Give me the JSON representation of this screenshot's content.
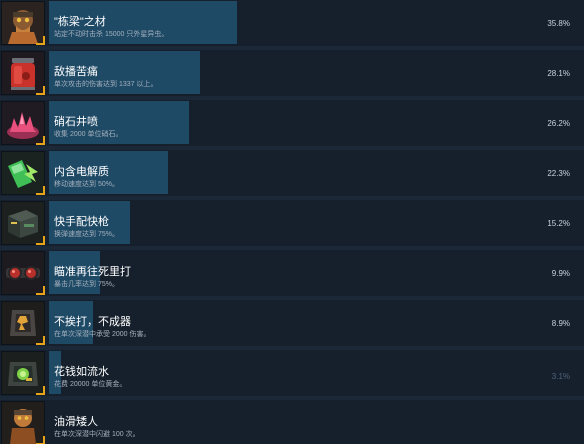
{
  "achievements": [
    {
      "title": "\"栋梁\"之材",
      "description": "站定不动时击杀 15000 只外星异虫。",
      "percent": "35.8%",
      "progress": 35.8,
      "icon": "hammer-dwarf-icon",
      "icon_color": "#b86a2f"
    },
    {
      "title": "敌播苦痛",
      "description": "单次攻击的伤害达到 1337 以上。",
      "percent": "28.1%",
      "progress": 28.1,
      "icon": "red-jar-icon",
      "icon_color": "#c8322a"
    },
    {
      "title": "硝石井喷",
      "description": "收集 2000 单位硝石。",
      "percent": "26.2%",
      "progress": 26.2,
      "icon": "pink-crystal-icon",
      "icon_color": "#e8507d"
    },
    {
      "title": "内含电解质",
      "description": "移动速度达到 50%。",
      "percent": "22.3%",
      "progress": 22.3,
      "icon": "energy-drink-icon",
      "icon_color": "#3fbf55"
    },
    {
      "title": "快手配快枪",
      "description": "换弹速度达到 75%。",
      "percent": "15.2%",
      "progress": 15.2,
      "icon": "ammo-crate-icon",
      "icon_color": "#5a8a5f"
    },
    {
      "title": "瞄准再往死里打",
      "description": "暴击几率达到 75%。",
      "percent": "9.9%",
      "progress": 9.9,
      "icon": "goggles-icon",
      "icon_color": "#b8302c"
    },
    {
      "title": "不挨打，不成器",
      "description": "在单次深潜中承受 2000 伤害。",
      "percent": "8.9%",
      "progress": 8.9,
      "icon": "armor-plate-icon",
      "icon_color": "#e0a43a"
    },
    {
      "title": "花钱如流水",
      "description": "花费 20000 单位黄金。",
      "percent": "3.1%",
      "progress": 3.1,
      "icon": "gold-case-icon",
      "icon_color": "#7fd14a"
    },
    {
      "title": "油滑矮人",
      "description": "在单次深潜中闪避 100 次。",
      "percent": "",
      "progress": 0,
      "icon": "dwarf-runner-icon",
      "icon_color": "#c07a3a"
    }
  ]
}
